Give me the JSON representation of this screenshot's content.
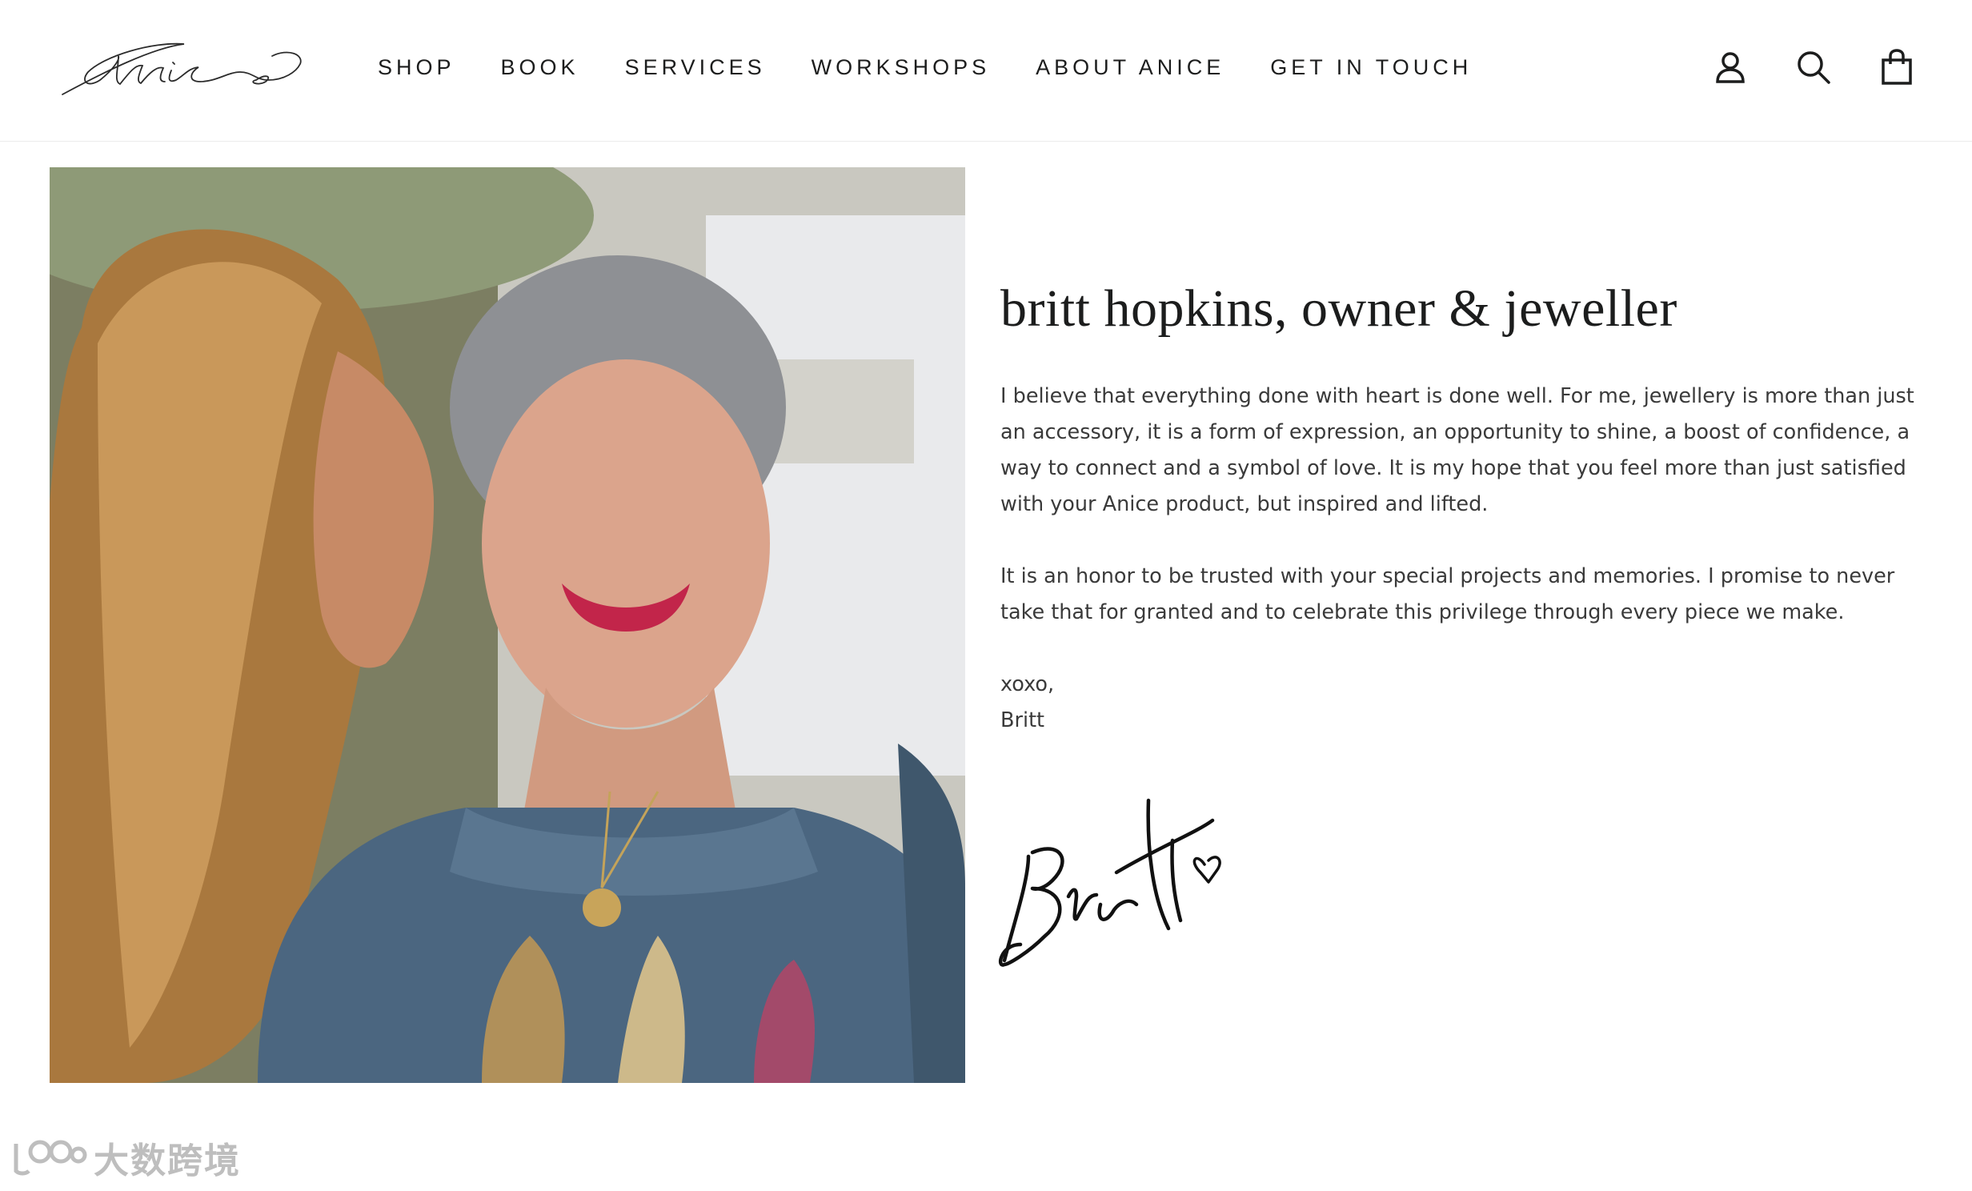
{
  "brand": {
    "logo_text": "Anice"
  },
  "nav": {
    "items": [
      {
        "label": "SHOP"
      },
      {
        "label": "BOOK"
      },
      {
        "label": "SERVICES"
      },
      {
        "label": "WORKSHOPS"
      },
      {
        "label": "ABOUT ANICE"
      },
      {
        "label": "GET IN TOUCH"
      }
    ]
  },
  "header_icons": [
    "account-icon",
    "search-icon",
    "cart-icon"
  ],
  "bio": {
    "title": "britt hopkins, owner & jeweller",
    "paragraph_1": "I believe that everything done with heart is done well. For me, jewellery is more than just an accessory, it is a form of expression, an opportunity to shine, a boost of confidence, a way to connect and a symbol of love. It is my hope that you feel more than just satisfied with your Anice product, but inspired and lifted.",
    "paragraph_2": "It is an honor to be trusted with your special projects and memories. I promise to never take that for granted and to celebrate this privilege through every piece we make.",
    "signoff_line_1": "xoxo,",
    "signoff_line_2": "Britt",
    "signature_text": "Britt"
  },
  "watermark": {
    "text": "大数跨境"
  },
  "colors": {
    "text": "#1c1d1d",
    "body_text": "#3a3a3a",
    "background": "#ffffff"
  }
}
